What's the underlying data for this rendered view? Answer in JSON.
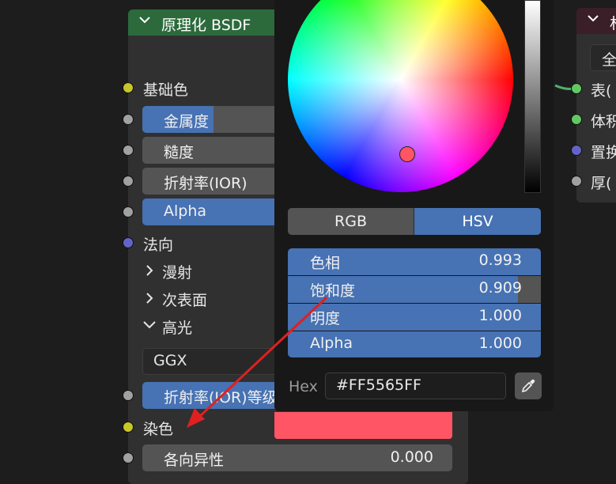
{
  "bsdf_node": {
    "title": "原理化 BSDF",
    "inputs": {
      "base_color": "基础色",
      "metallic": "金属度",
      "roughness": "糙度",
      "ior": "折射率(IOR)",
      "alpha": "Alpha",
      "normal": "法向",
      "diffuse": "漫射",
      "subsurface": "次表面",
      "specular": "高光",
      "distribution": "GGX",
      "ior_level": "折射率(IOR)等级",
      "tint": "染色",
      "anisotropic": "各向异性",
      "anisotropic_value": "0.000"
    }
  },
  "color_picker": {
    "tabs": {
      "rgb": "RGB",
      "hsv": "HSV"
    },
    "hue": {
      "label": "色相",
      "value": "0.993"
    },
    "saturation": {
      "label": "饱和度",
      "value": "0.909"
    },
    "value": {
      "label": "明度",
      "value": "1.000"
    },
    "alpha": {
      "label": "Alpha",
      "value": "1.000"
    },
    "hex_label": "Hex",
    "hex_value": "#FF5565FF",
    "current_color": "#FF5565"
  },
  "output_node": {
    "title": "材",
    "dropdown": "全",
    "inputs": {
      "surface": "表(",
      "volume": "体积",
      "displacement": "置换",
      "thickness": "厚("
    }
  },
  "colors": {
    "accent_blue": "#4772B3",
    "arrow_red": "#E02020",
    "shader_header": "#2C6A3C"
  }
}
